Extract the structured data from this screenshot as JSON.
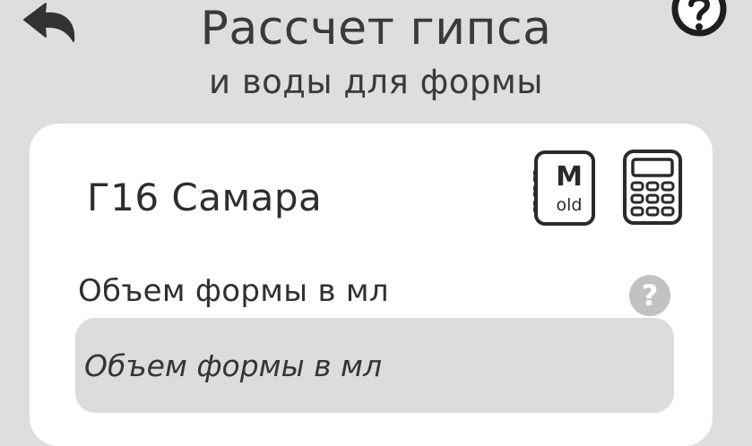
{
  "header": {
    "title": "Рассчет гипса",
    "subtitle": "и воды для формы",
    "back_icon": "undo-arrow-icon",
    "help_icon": "question-circle-icon"
  },
  "card": {
    "product_name": "Г16 Самара",
    "gypsum_button": {
      "icon": "gypsum-bag-icon",
      "letter": "M",
      "tag": "old"
    },
    "calculator_button": {
      "icon": "calculator-icon"
    },
    "volume_field": {
      "label": "Объем формы в мл",
      "placeholder": "Объем формы в мл",
      "value": "",
      "help_icon": "question-circle-icon",
      "help_glyph": "?"
    }
  },
  "colors": {
    "background": "#dedede",
    "card": "#ffffff",
    "text": "#3a3a3a",
    "input_bg": "#dcdcdc",
    "help_badge": "#c2c2c2"
  }
}
